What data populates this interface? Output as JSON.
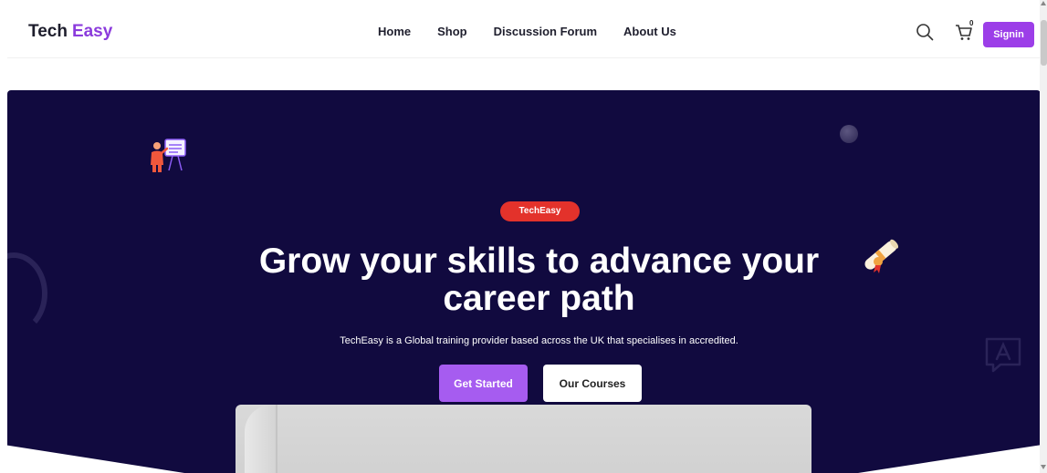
{
  "header": {
    "logo_part1": "Tech",
    "logo_part2": "Easy",
    "nav": [
      {
        "label": "Home"
      },
      {
        "label": "Shop"
      },
      {
        "label": "Discussion Forum"
      },
      {
        "label": "About Us"
      }
    ],
    "search_icon": "search-icon",
    "cart_icon": "cart-icon",
    "cart_count": "0",
    "signin_label": "Signin"
  },
  "hero": {
    "badge": "TechEasy",
    "title": "Grow your skills to advance your career path",
    "subtitle": "TechEasy is a Global training provider based across the UK that specialises in accredited.",
    "primary_button": "Get Started",
    "secondary_button": "Our Courses"
  },
  "colors": {
    "brand_purple": "#9c3ee8",
    "hero_bg": "#110a3f",
    "badge_red": "#e3322b"
  }
}
